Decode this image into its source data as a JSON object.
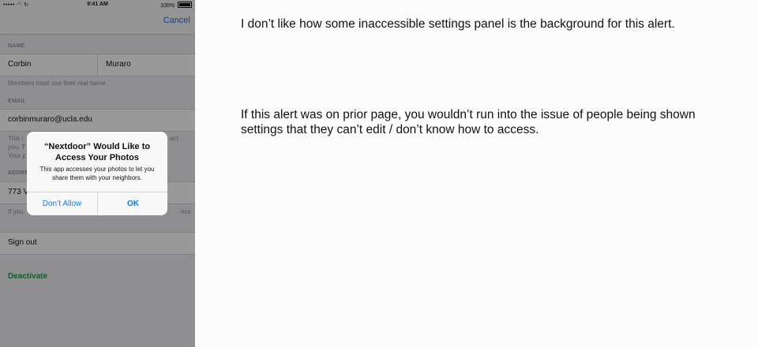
{
  "status_bar": {
    "carrier": "•••••",
    "time": "9:41 AM",
    "battery": "100%"
  },
  "nav_bar": {
    "cancel_label": "Cancel"
  },
  "form": {
    "name_label": "NAME",
    "first_name": "Corbin",
    "last_name": "Muraro",
    "name_help": "Members must use their real name.",
    "email_label": "EMAIL",
    "email_value": "corbinmuraro@ucla.edu",
    "email_help_lines": [
      "This i",
      "you. T",
      "Your p"
    ],
    "email_help_tail": "act",
    "address_label": "ADDRE",
    "address_value": "773 V",
    "address_help_head": "If you",
    "address_help_tail": "ess",
    "sign_out_label": "Sign out",
    "deactivate_label": "Deactivate"
  },
  "alert": {
    "title": "“Nextdoor” Would Like to Access Your Photos",
    "message": "This app accesses your photos to let you share them with your neighbors.",
    "deny_label": "Don’t Allow",
    "ok_label": "OK"
  },
  "commentary": {
    "note_1": "I don’t like how some inaccessible settings panel is the background for this alert.",
    "note_2": "If this alert was on prior page, you wouldn’t run into the issue of people being shown settings that they can’t edit / don’t know how to access."
  },
  "colors": {
    "accent": "#0a7aff",
    "deactivate": "#1b9b47",
    "dim_overlay": "rgba(0,0,0,0.40)"
  }
}
